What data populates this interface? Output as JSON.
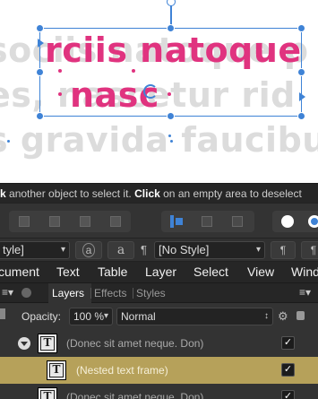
{
  "canvas": {
    "ghost_lines": [
      "sociis natoque p",
      "es, nascetur rid",
      "s gravida faucibu"
    ],
    "frame_lines": [
      "rciis natoque",
      "nasc"
    ]
  },
  "hint": {
    "part1": "k",
    "part2": " another object to select it. ",
    "part3": "Click",
    "part4": " on an empty area to deselect"
  },
  "stylebar": {
    "char_style": "tyle]",
    "chevron": "▾",
    "btn_a_circled": "a",
    "btn_a": "a",
    "pilcrow": "¶",
    "para_style": "[No Style]"
  },
  "menu": {
    "items": [
      "cument",
      "Text",
      "Table",
      "Layer",
      "Select",
      "View",
      "Wind"
    ]
  },
  "panel": {
    "tabs": [
      "Layers",
      "Effects",
      "Styles"
    ]
  },
  "layers": {
    "opacity_label": "Opacity:",
    "opacity_value": "100 %",
    "blend_mode": "Normal",
    "rows": [
      {
        "name": "(Donec sit amet neque. Don)",
        "visible": "✓"
      },
      {
        "name": "(Nested text frame)",
        "visible": "✓"
      },
      {
        "name": "(Donec sit amet neque. Don)",
        "visible": "✓"
      }
    ],
    "thumb_glyph": "T"
  },
  "colors": {
    "accent": "#3f83d6",
    "frame_text": "#e0337f",
    "selected_row": "#b6a15a"
  }
}
